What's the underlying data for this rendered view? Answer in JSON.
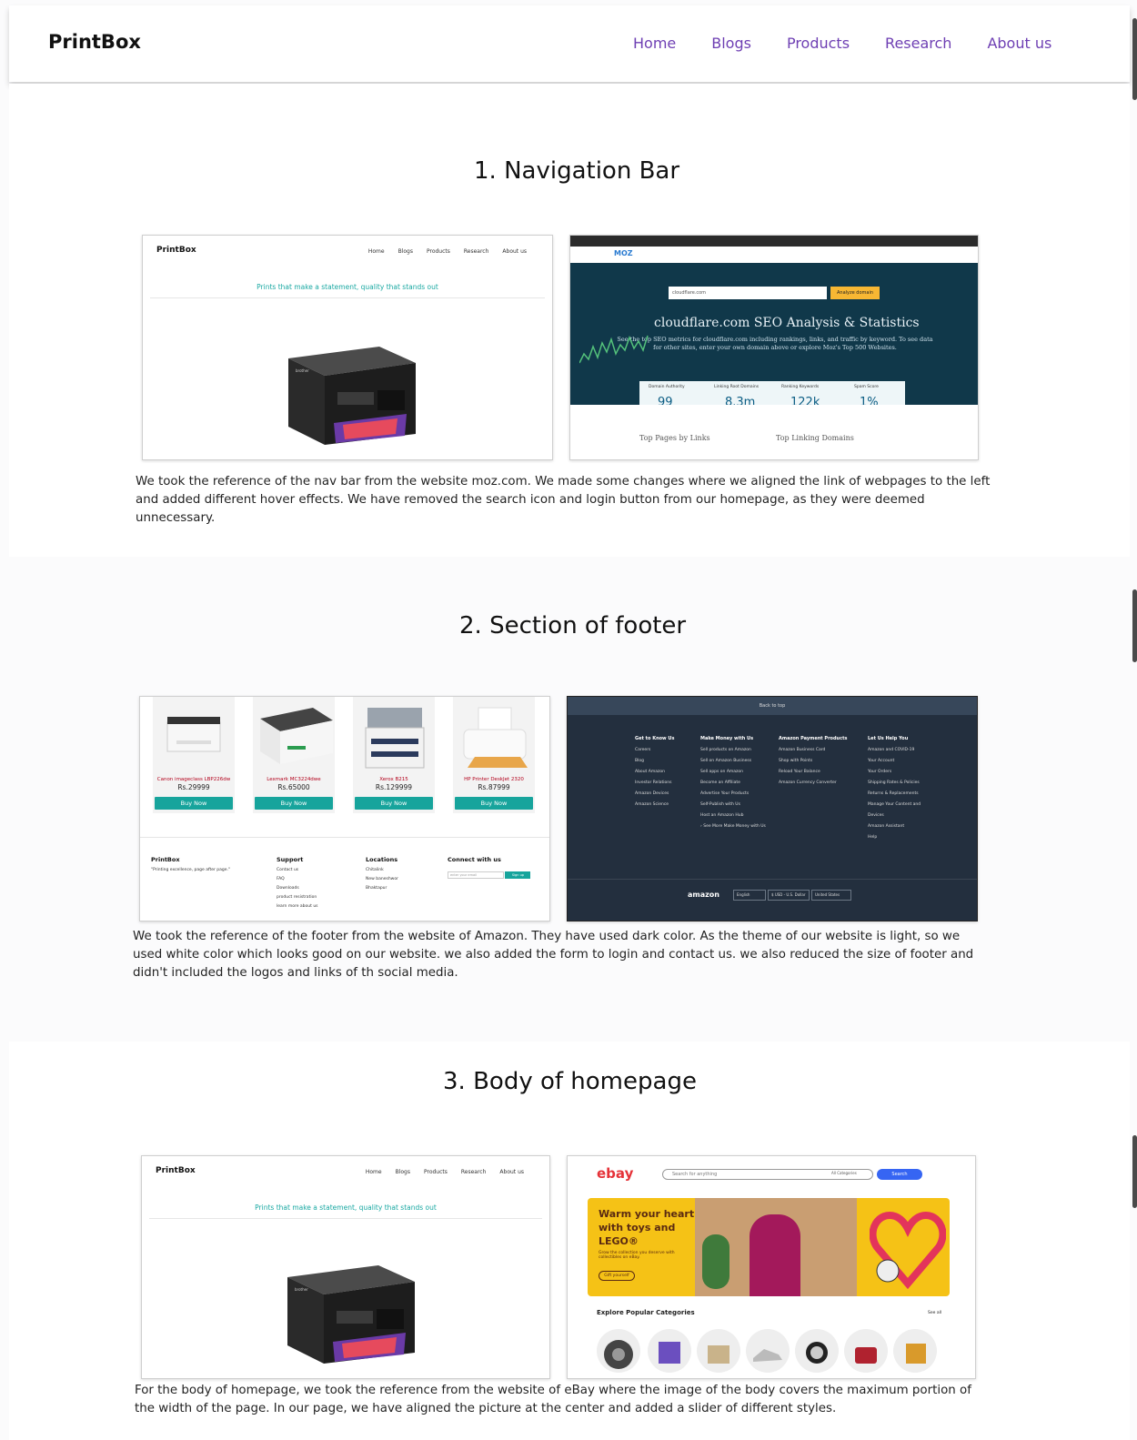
{
  "nav": {
    "brand": "PrintBox",
    "links": [
      "Home",
      "Blogs",
      "Products",
      "Research",
      "About us"
    ]
  },
  "sections": [
    {
      "title": "1. Navigation Bar",
      "description": "We took the reference of the nav bar from the website moz.com. We made some changes where we aligned the link of webpages to the left and added different hover effects. We have removed the search icon and login button from our homepage, as they were deemed unnecessary."
    },
    {
      "title": "2. Section of footer",
      "description": "We took the reference of the footer from the website of Amazon. They have used dark color. As the theme of our website is light, so we used white color which looks good on our website. we also added the form to login and contact us. we also reduced the size of footer and didn't included the logos and links of th social media."
    },
    {
      "title": "3. Body of homepage",
      "description": "For the body of homepage, we took the reference from the website of eBay where the image of the body covers the maximum portion of the width of the page. In our page, we have aligned the picture at the center and added a slider of different styles."
    }
  ],
  "mini_site": {
    "brand": "PrintBox",
    "links": [
      "Home",
      "Blogs",
      "Products",
      "Research",
      "About us"
    ],
    "tagline": "Prints that make a statement, quality that stands out"
  },
  "moz": {
    "logo": "MOZ",
    "input_value": "cloudflare.com",
    "analyze_button": "Analyze domain",
    "heading": "cloudflare.com SEO Analysis & Statistics",
    "sub": "See the top SEO metrics for cloudflare.com including rankings, links, and traffic by keyword. To see data for other sites, enter your own domain above or explore Moz's Top 500 Websites.",
    "stats": [
      {
        "label": "Domain Authority",
        "value": "99"
      },
      {
        "label": "Linking Root Domains",
        "value": "8.3m"
      },
      {
        "label": "Ranking Keywords",
        "value": "122k"
      },
      {
        "label": "Spam Score",
        "value": "1%"
      }
    ],
    "lower_left": "Top Pages by Links",
    "lower_right": "Top Linking Domains"
  },
  "footer_mock": {
    "products": [
      {
        "name": "Canon imageclass LBP226dw",
        "price": "Rs.29999",
        "button": "Buy Now"
      },
      {
        "name": "Lexmark MC3224dwe",
        "price": "Rs.65000",
        "button": "Buy Now"
      },
      {
        "name": "Xerox B215",
        "price": "Rs.129999",
        "button": "Buy Now"
      },
      {
        "name": "HP Printer DeskJet 2320",
        "price": "Rs.87999",
        "button": "Buy Now"
      }
    ],
    "brand": "PrintBox",
    "brand_tag": "\"Printing excellence, page after page.\"",
    "support_title": "Support",
    "support_items": [
      "Contact us",
      "FAQ",
      "Downloads",
      "product resistration",
      "learn more about us"
    ],
    "locations_title": "Locations",
    "locations_items": [
      "Chitalink",
      "New baneshwor",
      "Bhaktapur"
    ],
    "connect_title": "Connect with us",
    "email_placeholder": "enter your email",
    "signup": "Sign up"
  },
  "amazon": {
    "back_to_top": "Back to top",
    "cols": [
      {
        "title": "Get to Know Us",
        "items": [
          "Careers",
          "Blog",
          "About Amazon",
          "Investor Relations",
          "Amazon Devices",
          "Amazon Science"
        ]
      },
      {
        "title": "Make Money with Us",
        "items": [
          "Sell products on Amazon",
          "Sell on Amazon Business",
          "Sell apps on Amazon",
          "Become an Affiliate",
          "Advertise Your Products",
          "Self-Publish with Us",
          "Host an Amazon Hub",
          "› See More Make Money with Us"
        ]
      },
      {
        "title": "Amazon Payment Products",
        "items": [
          "Amazon Business Card",
          "Shop with Points",
          "Reload Your Balance",
          "Amazon Currency Converter"
        ]
      },
      {
        "title": "Let Us Help You",
        "items": [
          "Amazon and COVID-19",
          "Your Account",
          "Your Orders",
          "Shipping Rates & Policies",
          "Returns & Replacements",
          "Manage Your Content and Devices",
          "Amazon Assistant",
          "Help"
        ]
      }
    ],
    "logo": "amazon",
    "language": "English",
    "currency": "$ USD - U.S. Dollar",
    "country": "United States"
  },
  "ebay": {
    "logo": "ebay",
    "search_placeholder": "Search for anything",
    "category": "All Categories",
    "search_button": "Search",
    "hero_title": "Warm your heart with toys and LEGO®",
    "hero_sub": "Grow the collection you deserve with collectibles on eBay.",
    "hero_button": "Gift yourself",
    "explore": "Explore Popular Categories",
    "see_all": "See all"
  },
  "colors": {
    "nav_link": "#6e3fb3",
    "teal": "#17a49c",
    "moz_blue": "#10384a",
    "amazon_dark": "#232f3e",
    "ebay_yellow": "#f5c216"
  }
}
